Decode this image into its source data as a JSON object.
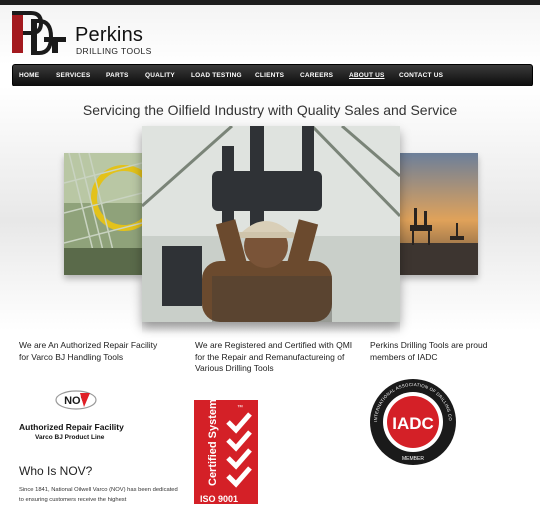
{
  "brand": {
    "logo_letters": "PDT",
    "name": "Perkins",
    "subtitle": "DRILLING TOOLS"
  },
  "nav": {
    "items": [
      "HOME",
      "SERVICES",
      "PARTS",
      "QUALITY",
      "LOAD TESTING",
      "CLIENTS",
      "CAREERS",
      "ABOUT US",
      "CONTACT US"
    ],
    "active": "ABOUT US"
  },
  "hero": {
    "tagline": "Servicing the Oilfield Industry with Quality Sales and Service"
  },
  "columns": [
    {
      "title": "We are An Authorized Repair Facility for Varco BJ Handling Tools",
      "logo_text": "NOV",
      "caption1": "Authorized Repair Facility",
      "caption2": "Varco BJ Product Line"
    },
    {
      "title": "We are Registered and Certified with QMI for the Repair and Remanufactureing of Various Drilling Tools",
      "badge_text": "Certified System",
      "badge_number": "ISO 9001"
    },
    {
      "title": "Perkins Drilling Tools are proud members of IADC",
      "badge_text": "IADC",
      "badge_ring": "INTERNATIONAL ASSOCIATION OF DRILLING CONTRACTORS",
      "badge_member": "MEMBER"
    }
  ],
  "who": {
    "title": "Who Is NOV?",
    "body": "Since 1841, National Oilwell Varco (NOV) has been dedicated to ensuring customers receive the highest"
  },
  "colors": {
    "nav_bg": "#1a1a1a",
    "logo_red": "#a3191e",
    "nov_red": "#e01f26",
    "cert_red": "#d42027"
  }
}
